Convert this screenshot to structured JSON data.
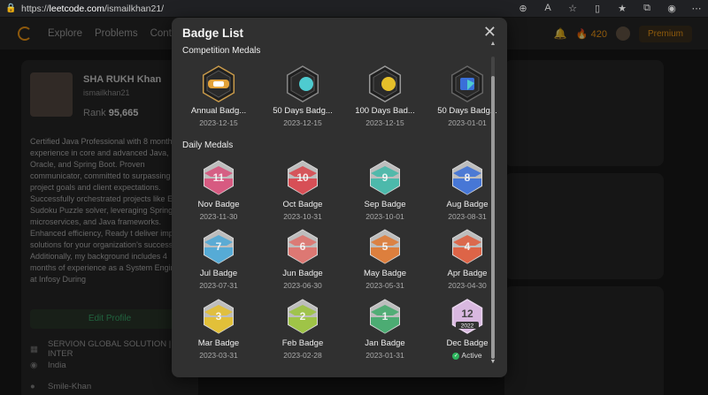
{
  "browser": {
    "url_prefix": "https://",
    "url_domain": "leetcode.com",
    "url_path": "/ismailkhan21/"
  },
  "header": {
    "nav": [
      "Explore",
      "Problems",
      "Contest"
    ],
    "coins": "420",
    "premium_label": "Premium"
  },
  "profile": {
    "name": "SHA RUKH Khan",
    "username": "ismailkhan21",
    "rank_label": "Rank",
    "rank_value": "95,665",
    "bio": "Certified Java Professional with 8 months experience in core and advanced Java, Oracle, and Spring Boot. Proven communicator, committed to surpassing project goals and client expectations. Successfully orchestrated projects like Ek and Sudoku Puzzle solver, leveraging Spring Boot, microservices, and Java frameworks. Enhanced efficiency, Ready t deliver impactful solutions for your organization's success. Additionally, my background includes 4 months of experience as a System Engineer at Infosy During",
    "edit_label": "Edit Profile",
    "company": "SERVION GLOBAL SOLUTION | INTER",
    "location": "India",
    "github": "Smile-Khan"
  },
  "modal": {
    "title": "Badge List",
    "competition_title": "Competition Medals",
    "daily_title": "Daily Medals",
    "competition": [
      {
        "name": "Annual Badg...",
        "date": "2023-12-15",
        "icon": "annual-badge-2023"
      },
      {
        "name": "50 Days Badg...",
        "date": "2023-12-15",
        "icon": "50-days-badge"
      },
      {
        "name": "100 Days Bad...",
        "date": "2023-12-15",
        "icon": "100-days-badge"
      },
      {
        "name": "50 Days Badg...",
        "date": "2023-01-01",
        "icon": "50-days-badge-2022"
      }
    ],
    "daily": [
      {
        "name": "Nov Badge",
        "date": "2023-11-30",
        "num": "11",
        "color": "#d94f7a"
      },
      {
        "name": "Oct Badge",
        "date": "2023-10-31",
        "num": "10",
        "color": "#d9434a"
      },
      {
        "name": "Sep Badge",
        "date": "2023-10-01",
        "num": "9",
        "color": "#3fb8a8"
      },
      {
        "name": "Aug Badge",
        "date": "2023-08-31",
        "num": "8",
        "color": "#3a6fd8"
      },
      {
        "name": "Jul Badge",
        "date": "2023-07-31",
        "num": "7",
        "color": "#4aa8d8"
      },
      {
        "name": "Jun Badge",
        "date": "2023-06-30",
        "num": "6",
        "color": "#e0706a"
      },
      {
        "name": "May Badge",
        "date": "2023-05-31",
        "num": "5",
        "color": "#e0782f"
      },
      {
        "name": "Apr Badge",
        "date": "2023-04-30",
        "num": "4",
        "color": "#e05a3a"
      },
      {
        "name": "Mar Badge",
        "date": "2023-03-31",
        "num": "3",
        "color": "#e6c02a"
      },
      {
        "name": "Feb Badge",
        "date": "2023-02-28",
        "num": "2",
        "color": "#9bc43a"
      },
      {
        "name": "Jan Badge",
        "date": "2023-01-31",
        "num": "1",
        "color": "#3faa6a"
      },
      {
        "name": "Dec Badge",
        "date": "",
        "num": "12",
        "year": "2022",
        "color": "#d9b8e0",
        "active_label": "Active"
      }
    ]
  }
}
